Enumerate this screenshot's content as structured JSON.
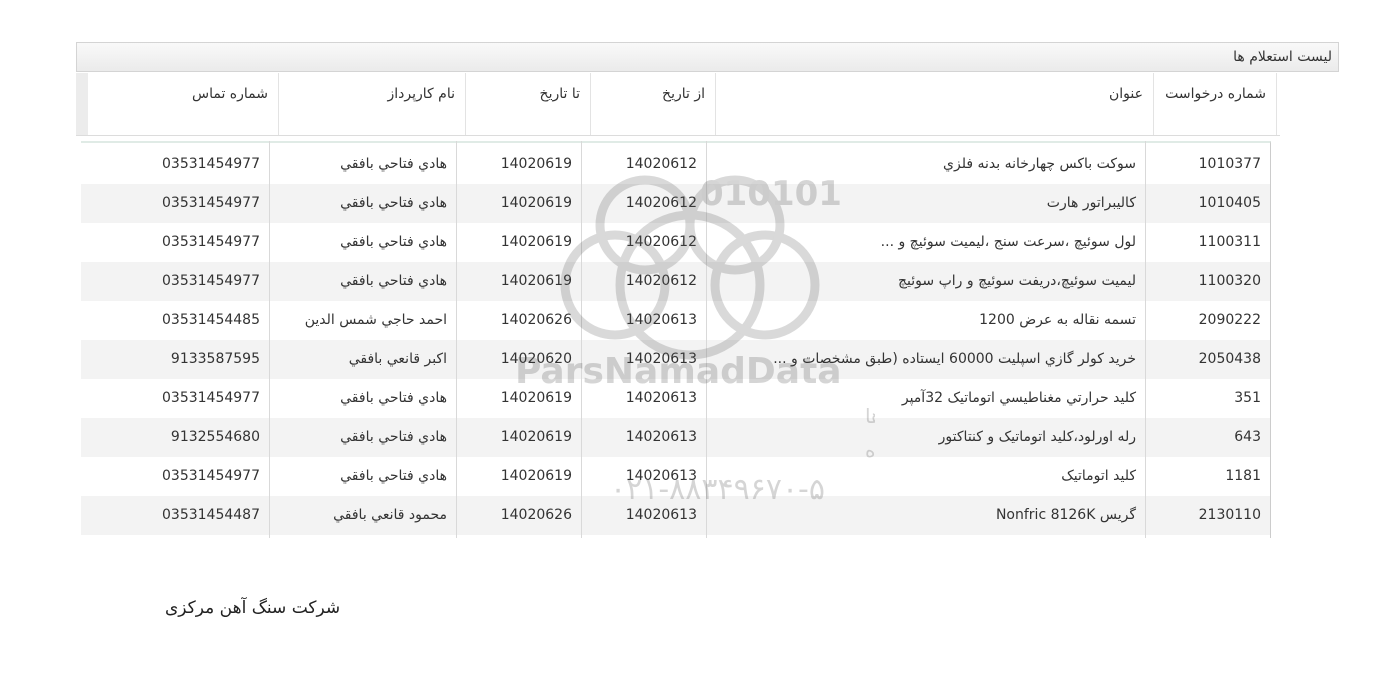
{
  "panel": {
    "title": "ليست استعلام ها"
  },
  "columns": {
    "request_no": "شماره درخواست",
    "subject": "عنوان",
    "from_date": "از تاريخ",
    "to_date": "تا تاريخ",
    "agent": "نام کارپرداز",
    "phone": "شماره تماس"
  },
  "rows": [
    {
      "request_no": "1010377",
      "subject": "سوکت باکس چهارخانه بدنه فلزي",
      "from_date": "14020612",
      "to_date": "14020619",
      "agent": "هادي فتاحي بافقي",
      "phone": "03531454977"
    },
    {
      "request_no": "1010405",
      "subject": "کاليبراتور هارت",
      "from_date": "14020612",
      "to_date": "14020619",
      "agent": "هادي فتاحي بافقي",
      "phone": "03531454977"
    },
    {
      "request_no": "1100311",
      "subject": "لول سوئيچ ،سرعت سنج ،ليميت سوئيچ و ...",
      "from_date": "14020612",
      "to_date": "14020619",
      "agent": "هادي فتاحي بافقي",
      "phone": "03531454977"
    },
    {
      "request_no": "1100320",
      "subject": "ليميت سوئيچ،دريفت سوئيچ و راپ سوئيچ",
      "from_date": "14020612",
      "to_date": "14020619",
      "agent": "هادي فتاحي بافقي",
      "phone": "03531454977"
    },
    {
      "request_no": "2090222",
      "subject": "تسمه نقاله به عرض 1200",
      "from_date": "14020613",
      "to_date": "14020626",
      "agent": "احمد حاجي شمس الدين",
      "phone": "03531454485"
    },
    {
      "request_no": "2050438",
      "subject": "خريد کولر گازي اسپليت 60000 ايستاده (طبق مشخصات و ...",
      "from_date": "14020613",
      "to_date": "14020620",
      "agent": "اکبر قانعي بافقي",
      "phone": "9133587595"
    },
    {
      "request_no": "351",
      "subject": "کليد حرارتي مغناطيسي اتوماتيک 32آمپر",
      "from_date": "14020613",
      "to_date": "14020619",
      "agent": "هادي فتاحي بافقي",
      "phone": "03531454977"
    },
    {
      "request_no": "643",
      "subject": "رله اورلود،کليد اتوماتيک و کنتاکتور",
      "from_date": "14020613",
      "to_date": "14020619",
      "agent": "هادي فتاحي بافقي",
      "phone": "9132554680"
    },
    {
      "request_no": "1181",
      "subject": "کليد اتوماتيک",
      "from_date": "14020613",
      "to_date": "14020619",
      "agent": "هادي فتاحي بافقي",
      "phone": "03531454977"
    },
    {
      "request_no": "2130110",
      "subject": "گريس Nonfric 8126K",
      "from_date": "14020613",
      "to_date": "14020626",
      "agent": "محمود قانعي بافقي",
      "phone": "03531454487"
    }
  ],
  "watermark": {
    "brand": "ParsNamadData",
    "line1": "مرکز فرآوری اطلاعات پارس نماد داده ها",
    "line2": "پایگاه اطلاع رسانی مناقصه و مزایده",
    "phone": "۰۲۱-۸۸۳۴۹۶۷۰-۵",
    "digits": "010101"
  },
  "footer": {
    "company": "شرکت سنگ آهن مرکزی"
  }
}
